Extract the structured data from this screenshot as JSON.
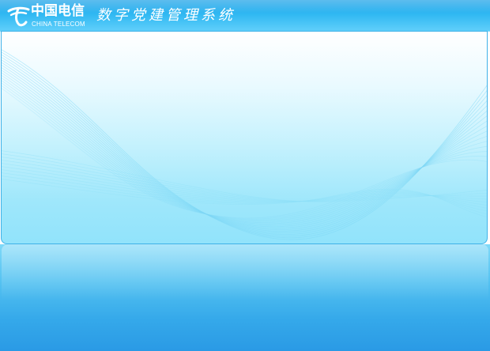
{
  "header": {
    "logo_cn": "中国电信",
    "logo_en": "CHINA TELECOM",
    "system_title": "数字党建管理系统"
  },
  "icons": {
    "logo_mark": "china-telecom-logo-icon"
  },
  "colors": {
    "header_blue": "#30b8f2",
    "panel_cyan": "#9fe7fb",
    "reflection_blue": "#2a9ae5",
    "wave_line": "#7fd8f6"
  }
}
